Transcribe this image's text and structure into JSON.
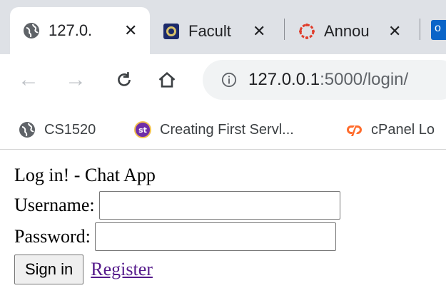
{
  "tabs": [
    {
      "label": "127.0.",
      "icon": "globe-icon"
    },
    {
      "label": "Facult",
      "icon": "university-seal-icon"
    },
    {
      "label": "Annou",
      "icon": "canvas-logo-icon"
    }
  ],
  "toolbar": {
    "url_host": "127.0.0.1",
    "url_path": ":5000/login/",
    "back_icon": "back-arrow-icon",
    "forward_icon": "forward-arrow-icon",
    "reload_icon": "reload-icon",
    "home_icon": "home-icon",
    "info_icon": "info-icon"
  },
  "bookmarks": [
    {
      "label": "CS1520",
      "icon": "globe-icon"
    },
    {
      "label": "Creating First Servl...",
      "icon": "st-logo-icon"
    },
    {
      "label": "cPanel Lo",
      "icon": "cpanel-logo-icon"
    }
  ],
  "page": {
    "title": "Log in! - Chat App",
    "username_label": "Username:",
    "username_value": "",
    "password_label": "Password:",
    "password_value": "",
    "submit_label": "Sign in",
    "register_link": "Register"
  }
}
